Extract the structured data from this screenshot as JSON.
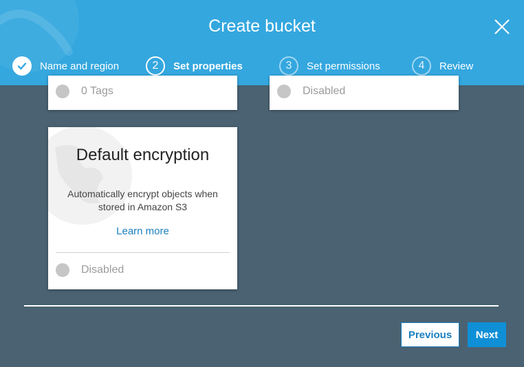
{
  "dialog": {
    "title": "Create bucket",
    "accent_color": "#34a7df",
    "backdrop_color": "#4a6272"
  },
  "steps": [
    {
      "label": "Name and region",
      "number": "",
      "state": "done",
      "icon": "check-icon"
    },
    {
      "label": "Set properties",
      "number": "2",
      "state": "current"
    },
    {
      "label": "Set permissions",
      "number": "3",
      "state": "upcoming"
    },
    {
      "label": "Review",
      "number": "4",
      "state": "upcoming"
    }
  ],
  "cards": {
    "tags": {
      "status": "0 Tags"
    },
    "right": {
      "status": "Disabled"
    },
    "encryption": {
      "title": "Default encryption",
      "description": "Automatically encrypt objects when stored in Amazon S3",
      "learn_more": "Learn more",
      "status": "Disabled"
    }
  },
  "footer": {
    "previous_label": "Previous",
    "next_label": "Next",
    "next_color": "#0f8fd6"
  }
}
